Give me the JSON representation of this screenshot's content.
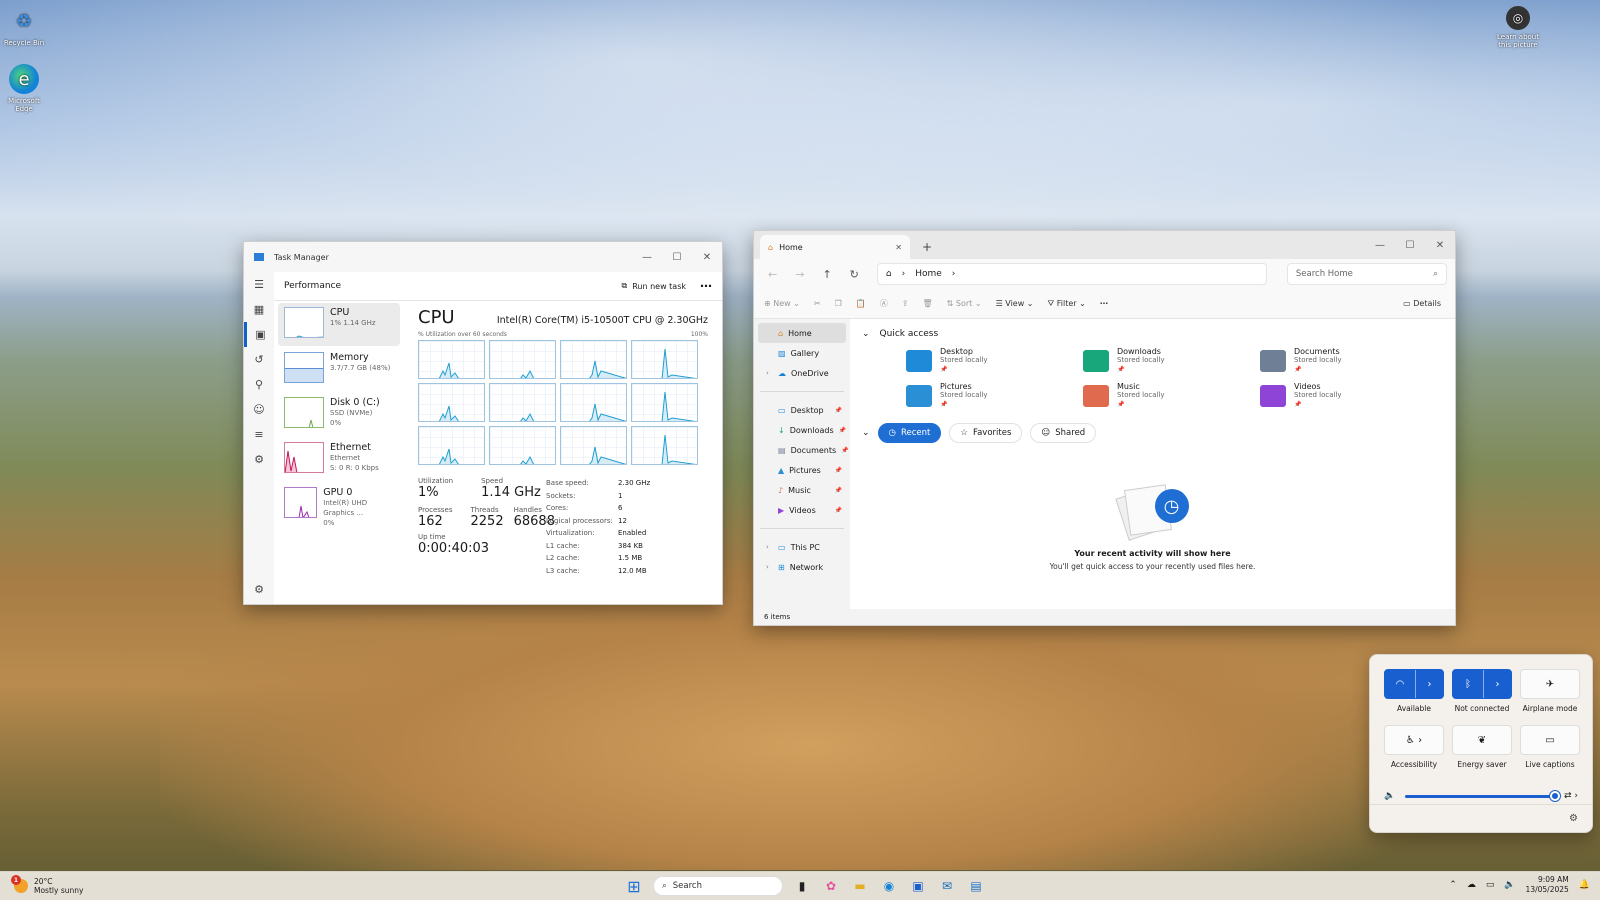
{
  "desktop": {
    "icons": [
      {
        "label": "Recycle Bin",
        "icon": "recycle-bin-icon"
      },
      {
        "label": "Microsoft Edge",
        "icon": "edge-icon"
      },
      {
        "label": "Learn about this picture",
        "icon": "camera-icon"
      }
    ]
  },
  "task_manager": {
    "title": "Task Manager",
    "section": "Performance",
    "run_new_task": "Run new task",
    "items": [
      {
        "name": "CPU",
        "sub1": "1% 1.14 GHz",
        "sub2": ""
      },
      {
        "name": "Memory",
        "sub1": "3.7/7.7 GB (48%)",
        "sub2": ""
      },
      {
        "name": "Disk 0 (C:)",
        "sub1": "SSD (NVMe)",
        "sub2": "0%"
      },
      {
        "name": "Ethernet",
        "sub1": "Ethernet",
        "sub2": "S: 0 R: 0 Kbps"
      },
      {
        "name": "GPU 0",
        "sub1": "Intel(R) UHD Graphics ...",
        "sub2": "0%"
      }
    ],
    "cpu": {
      "heading": "CPU",
      "model": "Intel(R) Core(TM) i5-10500T CPU @ 2.30GHz",
      "util_label": "% Utilization over 60 seconds",
      "util_max": "100%",
      "utilization_label": "Utilization",
      "utilization": "1%",
      "speed_label": "Speed",
      "speed": "1.14 GHz",
      "processes_label": "Processes",
      "processes": "162",
      "threads_label": "Threads",
      "threads": "2252",
      "handles_label": "Handles",
      "handles": "68688",
      "uptime_label": "Up time",
      "uptime": "0:00:40:03",
      "specs": [
        {
          "k": "Base speed:",
          "v": "2.30 GHz"
        },
        {
          "k": "Sockets:",
          "v": "1"
        },
        {
          "k": "Cores:",
          "v": "6"
        },
        {
          "k": "Logical processors:",
          "v": "12"
        },
        {
          "k": "Virtualization:",
          "v": "Enabled"
        },
        {
          "k": "L1 cache:",
          "v": "384 KB"
        },
        {
          "k": "L2 cache:",
          "v": "1.5 MB"
        },
        {
          "k": "L3 cache:",
          "v": "12.0 MB"
        }
      ]
    }
  },
  "explorer": {
    "tab_title": "Home",
    "address": "Home",
    "search_placeholder": "Search Home",
    "commands": {
      "new": "New",
      "sort": "Sort",
      "view": "View",
      "filter": "Filter",
      "details": "Details"
    },
    "sidebar": [
      {
        "label": "Home",
        "pinned": false
      },
      {
        "label": "Gallery",
        "pinned": false
      },
      {
        "label": "OneDrive",
        "pinned": false
      },
      {
        "label": "Desktop",
        "pinned": true
      },
      {
        "label": "Downloads",
        "pinned": true
      },
      {
        "label": "Documents",
        "pinned": true
      },
      {
        "label": "Pictures",
        "pinned": true
      },
      {
        "label": "Music",
        "pinned": true
      },
      {
        "label": "Videos",
        "pinned": true
      },
      {
        "label": "This PC",
        "pinned": false
      },
      {
        "label": "Network",
        "pinned": false
      }
    ],
    "quick_access_title": "Quick access",
    "quick_access": [
      {
        "name": "Desktop",
        "sub": "Stored locally",
        "color": "#1f8ad8"
      },
      {
        "name": "Downloads",
        "sub": "Stored locally",
        "color": "#18a77b"
      },
      {
        "name": "Documents",
        "sub": "Stored locally",
        "color": "#6f7f95"
      },
      {
        "name": "Pictures",
        "sub": "Stored locally",
        "color": "#2b8fd6"
      },
      {
        "name": "Music",
        "sub": "Stored locally",
        "color": "#e06a4d"
      },
      {
        "name": "Videos",
        "sub": "Stored locally",
        "color": "#8e44d6"
      }
    ],
    "pills": {
      "recent": "Recent",
      "favorites": "Favorites",
      "shared": "Shared"
    },
    "empty_heading": "Your recent activity will show here",
    "empty_text": "You'll get quick access to your recently used files here.",
    "status": "6 items"
  },
  "quick_settings": {
    "tiles": [
      {
        "label": "Available",
        "on": true,
        "icon": "wifi-icon"
      },
      {
        "label": "Not connected",
        "on": true,
        "icon": "bluetooth-icon"
      },
      {
        "label": "Airplane mode",
        "on": false,
        "icon": "airplane-icon"
      },
      {
        "label": "Accessibility",
        "on": false,
        "icon": "accessibility-icon"
      },
      {
        "label": "Energy saver",
        "on": false,
        "icon": "leaf-icon"
      },
      {
        "label": "Live captions",
        "on": false,
        "icon": "captions-icon"
      }
    ],
    "volume": 100
  },
  "taskbar": {
    "temp": "20°C",
    "weather": "Mostly sunny",
    "weather_badge": "1",
    "search": "Search",
    "time": "9:09 AM",
    "date": "13/05/2025"
  },
  "colors": {
    "accent": "#1a5fd0",
    "cpu_line": "#1f9fd1",
    "ethernet_line": "#c2185b",
    "gpu_line": "#9c27b0"
  }
}
